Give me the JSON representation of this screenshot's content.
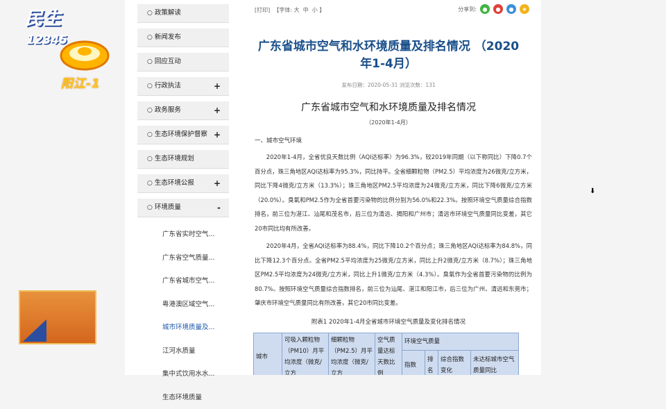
{
  "logo": {
    "text": "阳江-1"
  },
  "badge": {
    "title": "民生",
    "number": "12345"
  },
  "sidebar": {
    "items": [
      {
        "label": "政策解读",
        "toggle": ""
      },
      {
        "label": "新闻发布",
        "toggle": ""
      },
      {
        "label": "回应互动",
        "toggle": ""
      },
      {
        "label": "行政执法",
        "toggle": "+"
      },
      {
        "label": "政务服务",
        "toggle": "+"
      },
      {
        "label": "生态环境保护督察",
        "toggle": "+"
      },
      {
        "label": "生态环境规划",
        "toggle": ""
      },
      {
        "label": "生态环境公报",
        "toggle": "+"
      },
      {
        "label": "环境质量",
        "toggle": "-"
      }
    ],
    "subitems": [
      "广东省实时空气...",
      "广东省空气质量...",
      "广东省城市空气...",
      "粤港澳区域空气...",
      "城市环境质量及...",
      "江河水质量",
      "集中式饮用水水...",
      "生态环境质量"
    ]
  },
  "toolbar": {
    "print": "[打印]",
    "font_label": "【字体:",
    "font_large": "大",
    "font_medium": "中",
    "font_small": "小",
    "font_end": "】",
    "share_label": "分享到:"
  },
  "article": {
    "title_line1": "广东省城市空气和水环境质量及排名情况  （2020",
    "title_line2": "年1-4月）",
    "meta": "发布日期：2020-05-31  浏览次数：131",
    "subtitle": "广东省城市空气和水环境质量及排名情况",
    "period": "（2020年1-4月）",
    "section1": "一、城市空气环境",
    "para1": "2020年1-4月，全省优良天数比例（AQI达标率）为96.3%，较2019年同期（以下称同比）下降0.7个百分点，珠三角地区AQI达标率为95.3%，同比持平。全省细颗粒物（PM2.5）平均浓度为26微克/立方米，同比下降4微克/立方米（13.3%）；珠三角地区PM2.5平均浓度为24微克/立方米，同比下降6微克/立方米（20.0%）。臭氧和PM2.5作为全省首要污染物的比例分别为56.0%和22.3%。按照环境空气质量综合指数排名，前三位为湛江、汕尾和茂名市，后三位为清远、揭阳和广州市；清远市环境空气质量同比变差，其它20市同比均有所改善。",
    "para2": "2020年4月，全省AQI达标率为88.4%，同比下降10.2个百分点；珠三角地区AQI达标率为84.8%，同比下降12.3个百分点。全省PM2.5平均浓度为25微克/立方米，同比上升2微克/立方米（8.7%）；珠三角地区PM2.5平均浓度为24微克/立方米，同比上升1微克/立方米（4.3%）。臭氧作为全省首要污染物的比例为80.7%。按照环境空气质量综合指数排名，前三位为汕尾、湛江和阳江市，后三位为广州、清远和东莞市；肇庆市环境空气质量同比有所改善，其它20市同比变差。",
    "table_caption": "附表1  2020年1-4月全省城市环境空气质量及变化排名情况"
  },
  "table": {
    "col_city": "城市",
    "col_pm10": "可吸入颗粒物（PM10）月平均浓度（微克/立方",
    "col_pm25": "细颗粒物（PM2.5）月平均浓度（微克/立方",
    "col_aqi": "空气质量达标天数比例",
    "col_group": "环境空气质量",
    "col_index": "指数",
    "col_rank": "排名",
    "col_change": "综合指数变化",
    "col_nonstandard": "未达标城市空气质量同比"
  },
  "colors": {
    "title": "#1a4f8a",
    "table_bg": "#cfdcf0",
    "badge": "#e8923c",
    "logo": "#ffc61a"
  }
}
